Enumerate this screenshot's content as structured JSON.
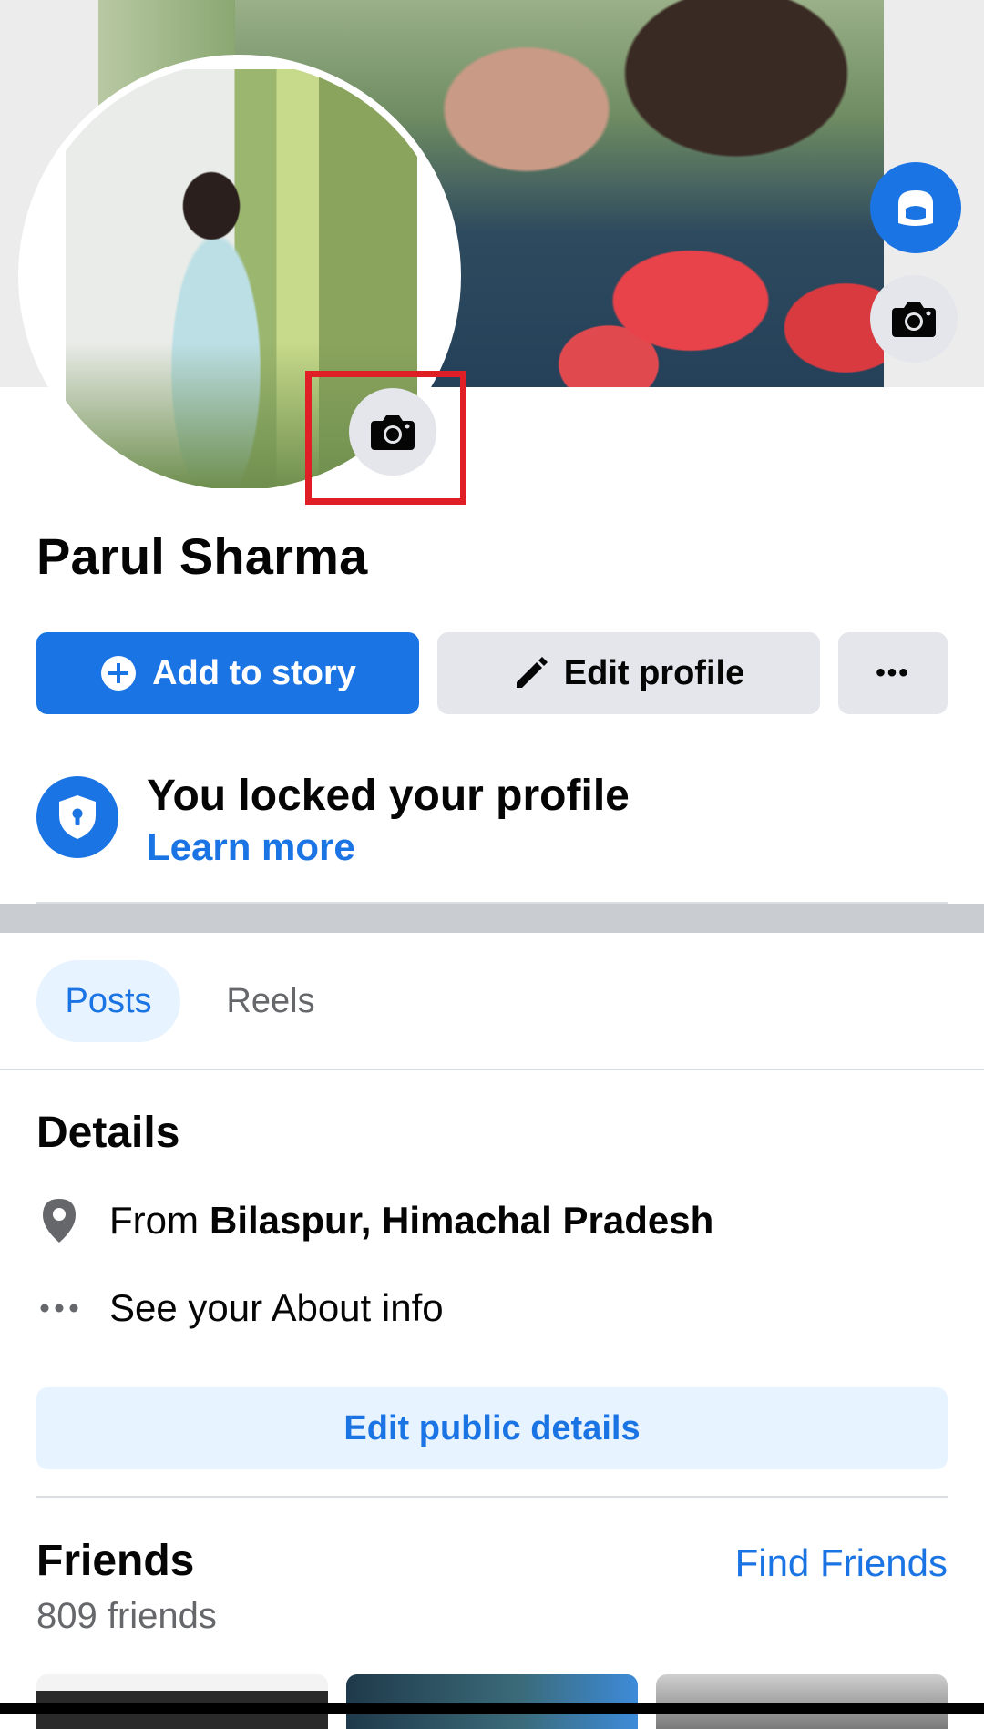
{
  "profile": {
    "name": "Parul Sharma"
  },
  "actions": {
    "add_story_label": "Add to story",
    "edit_profile_label": "Edit profile",
    "more_label": "•••"
  },
  "lock_notice": {
    "title": "You locked your profile",
    "link": "Learn more"
  },
  "tabs": [
    {
      "label": "Posts",
      "active": true
    },
    {
      "label": "Reels",
      "active": false
    }
  ],
  "details": {
    "heading": "Details",
    "from_prefix": "From",
    "from_place": "Bilaspur, Himachal Pradesh",
    "about_label": "See your About info",
    "edit_button": "Edit public details"
  },
  "friends": {
    "heading": "Friends",
    "find_link": "Find Friends",
    "count_text": "809 friends"
  },
  "colors": {
    "accent": "#1b74e4",
    "highlight": "#e01e26"
  },
  "icons": {
    "cover_camera": "camera-icon",
    "profile_camera": "camera-icon",
    "avatar_button": "avatar-icon",
    "story_plus": "plus-circle-icon",
    "edit": "pencil-icon",
    "lock": "shield-lock-icon",
    "location": "location-pin-icon",
    "more": "ellipsis-icon"
  }
}
